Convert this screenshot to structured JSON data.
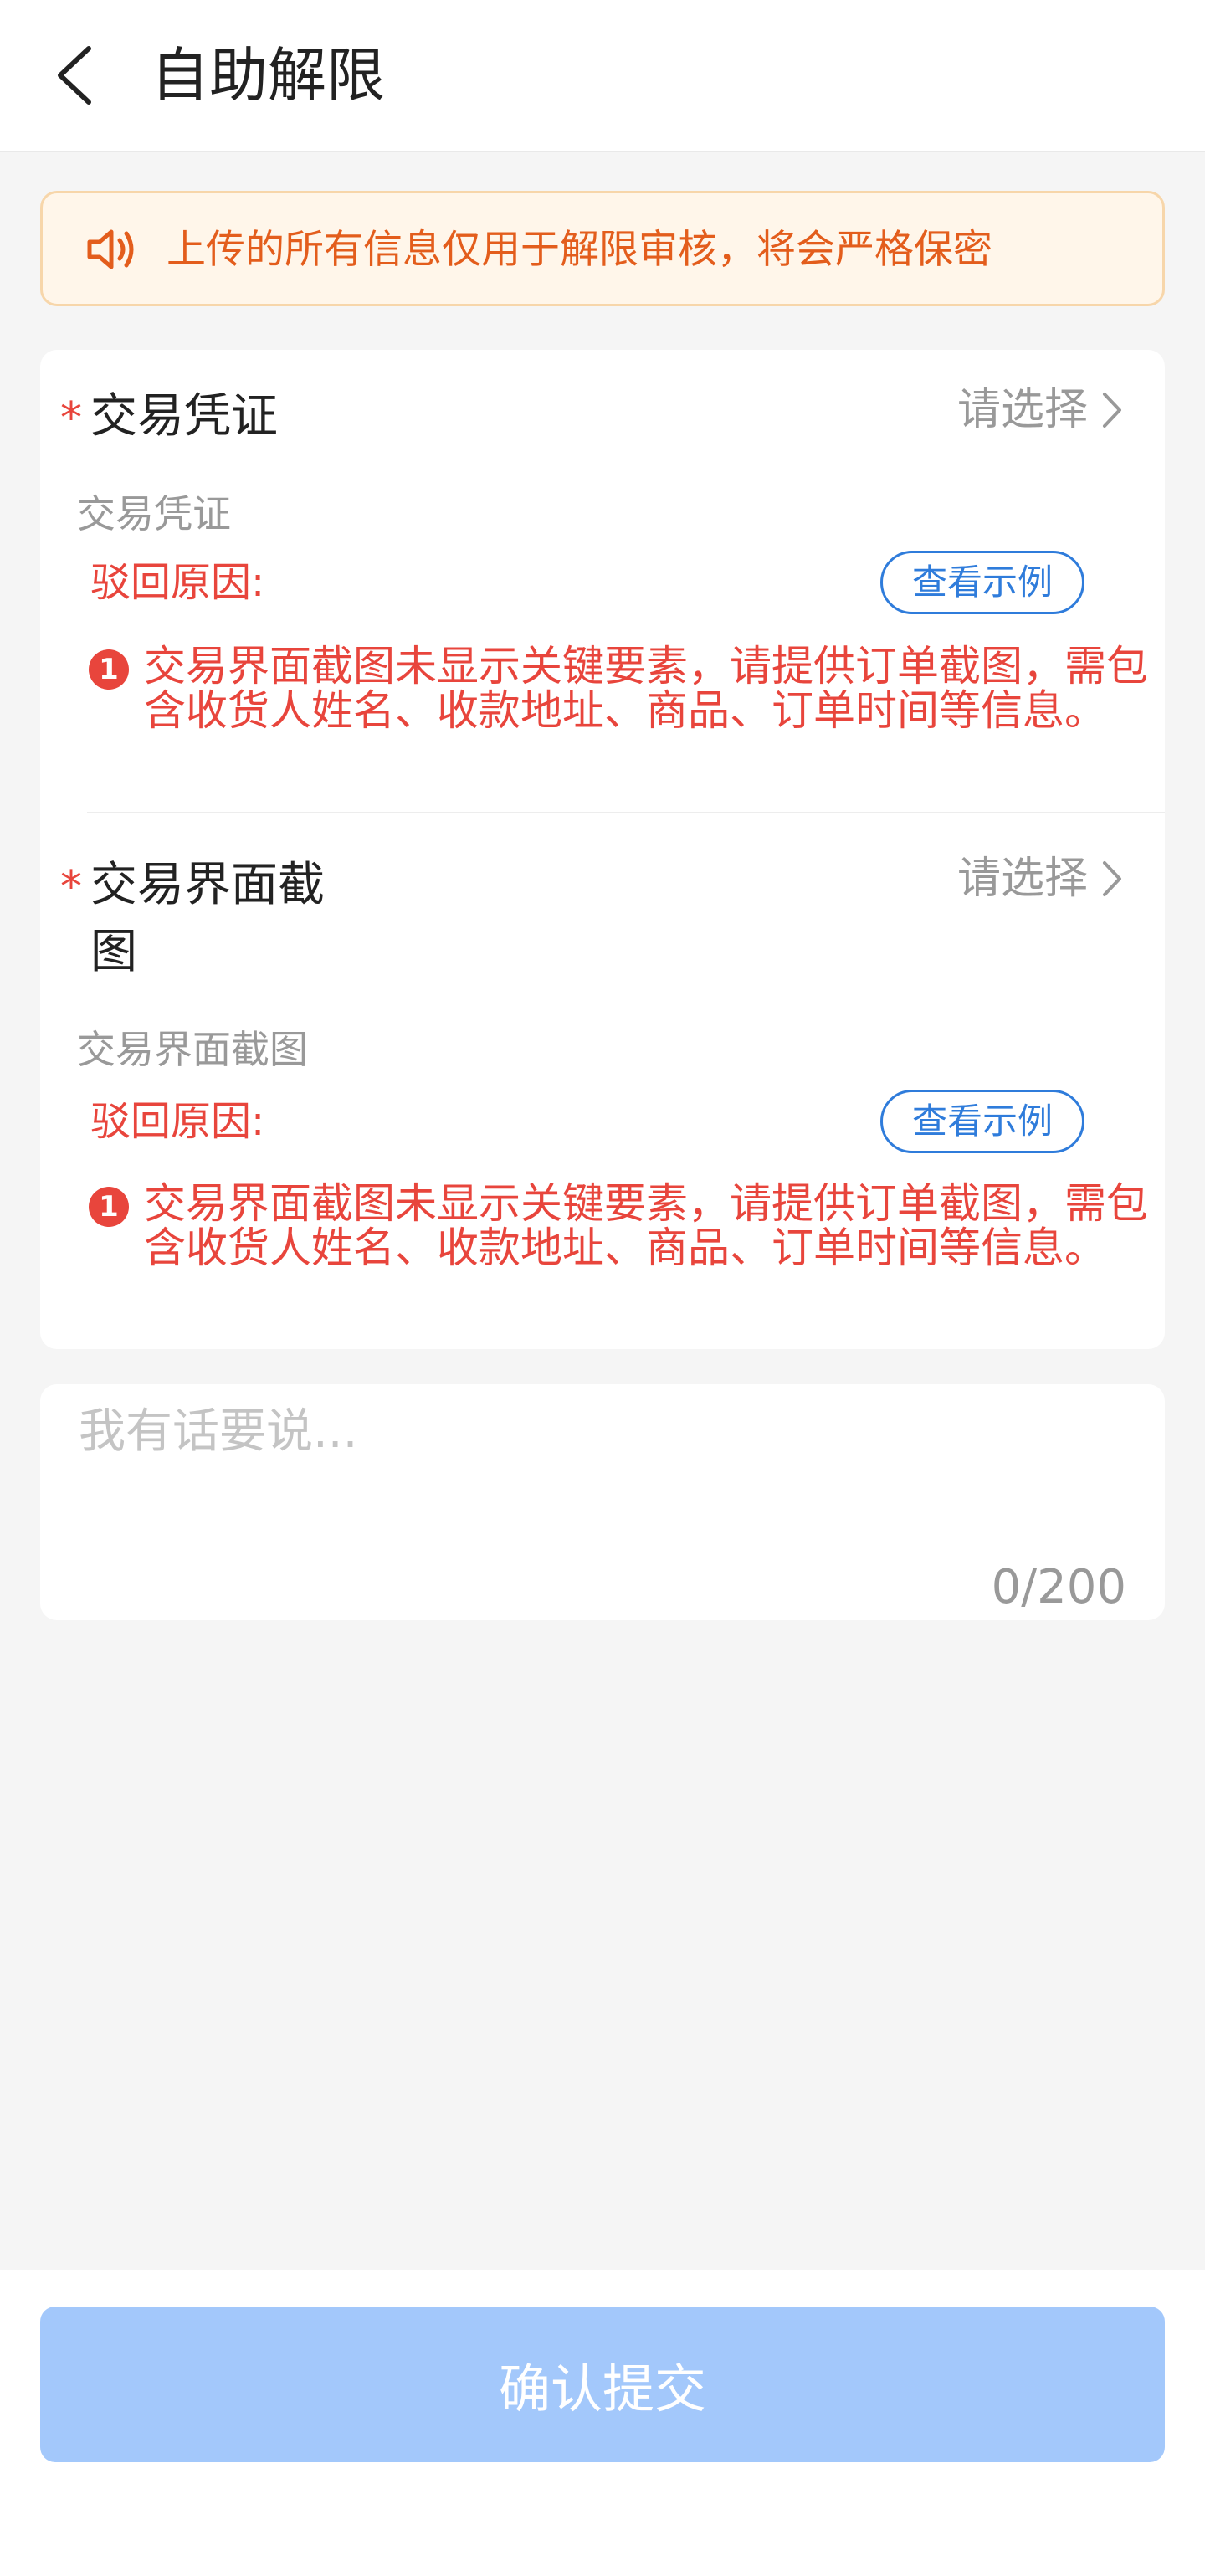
{
  "header": {
    "title": "自助解限"
  },
  "notice": {
    "text": "上传的所有信息仅用于解限审核，将会严格保密"
  },
  "sections": [
    {
      "required_mark": "*",
      "label": "交易凭证",
      "select_text": "请选择",
      "sub_label": "交易凭证",
      "reject_label": "驳回原因:",
      "example_button": "查看示例",
      "warn_number": "1",
      "reason": "交易界面截图未显示关键要素，请提供订单截图，需包含收货人姓名、收款地址、商品、订单时间等信息。"
    },
    {
      "required_mark": "*",
      "label": "交易界面截图",
      "select_text": "请选择",
      "sub_label": "交易界面截图",
      "reject_label": "驳回原因:",
      "example_button": "查看示例",
      "warn_number": "1",
      "reason": "交易界面截图未显示关键要素，请提供订单截图，需包含收货人姓名、收款地址、商品、订单时间等信息。"
    }
  ],
  "comment": {
    "placeholder": "我有话要说...",
    "count": "0/200"
  },
  "footer": {
    "submit_label": "确认提交"
  },
  "colors": {
    "accent": "#2f7cdb",
    "error": "#e8453c",
    "notice": "#e35d1c",
    "submit_disabled": "#a3c8fb"
  }
}
